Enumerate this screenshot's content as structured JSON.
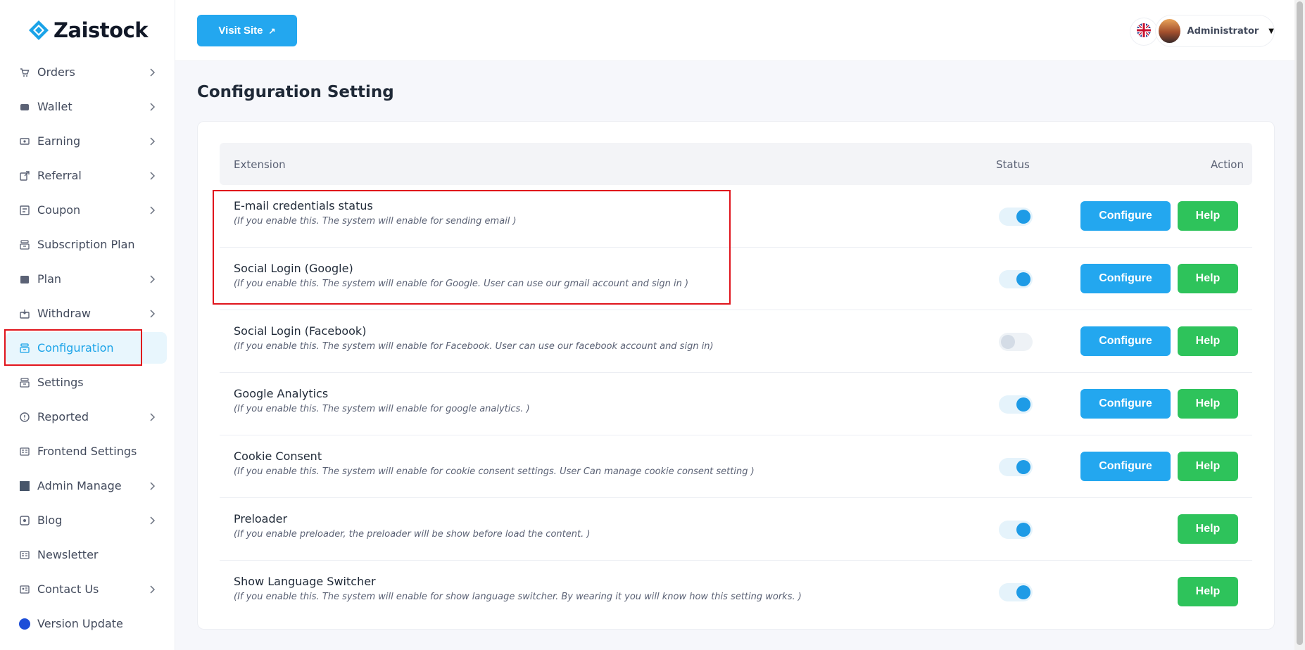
{
  "app": {
    "logo_text": "Zaistock",
    "brand_color": "#1aa3e8"
  },
  "sidebar": {
    "items": [
      {
        "label": "Orders",
        "icon": "cart-icon",
        "has_chevron": true,
        "active": false
      },
      {
        "label": "Wallet",
        "icon": "wallet-icon",
        "has_chevron": true,
        "active": false
      },
      {
        "label": "Earning",
        "icon": "money-icon",
        "has_chevron": true,
        "active": false
      },
      {
        "label": "Referral",
        "icon": "share-icon",
        "has_chevron": true,
        "active": false
      },
      {
        "label": "Coupon",
        "icon": "coupon-icon",
        "has_chevron": true,
        "active": false
      },
      {
        "label": "Subscription Plan",
        "icon": "stack-icon",
        "has_chevron": false,
        "active": false
      },
      {
        "label": "Plan",
        "icon": "calendar-icon",
        "has_chevron": true,
        "active": false
      },
      {
        "label": "Withdraw",
        "icon": "withdraw-icon",
        "has_chevron": true,
        "active": false
      },
      {
        "label": "Configuration",
        "icon": "stack-icon",
        "has_chevron": false,
        "active": true
      },
      {
        "label": "Settings",
        "icon": "stack-icon",
        "has_chevron": false,
        "active": false
      },
      {
        "label": "Reported",
        "icon": "alert-icon",
        "has_chevron": true,
        "active": false
      },
      {
        "label": "Frontend Settings",
        "icon": "layout-icon",
        "has_chevron": false,
        "active": false
      },
      {
        "label": "Admin Manage",
        "icon": "square-icon",
        "has_chevron": true,
        "active": false
      },
      {
        "label": "Blog",
        "icon": "blog-icon",
        "has_chevron": true,
        "active": false
      },
      {
        "label": "Newsletter",
        "icon": "layout-icon",
        "has_chevron": false,
        "active": false
      },
      {
        "label": "Contact Us",
        "icon": "contact-card-icon",
        "has_chevron": true,
        "active": false
      },
      {
        "label": "Version Update",
        "icon": "circle-icon",
        "has_chevron": false,
        "active": false
      }
    ]
  },
  "topbar": {
    "visit_label": "Visit Site",
    "visit_icon": "external-arrow-icon",
    "language_icon": "uk-flag-icon",
    "user_name": "Administrator",
    "user_caret": "▼"
  },
  "page": {
    "title": "Configuration Setting"
  },
  "table": {
    "headers": {
      "extension": "Extension",
      "status": "Status",
      "action": "Action"
    },
    "configure_label": "Configure",
    "help_label": "Help",
    "rows": [
      {
        "title": "E-mail credentials status",
        "desc": "(If you enable this. The system will enable for sending email )",
        "enabled": true,
        "configurable": true
      },
      {
        "title": "Social Login (Google)",
        "desc": "(If you enable this. The system will enable for Google. User can use our gmail account and sign in )",
        "enabled": true,
        "configurable": true
      },
      {
        "title": "Social Login (Facebook)",
        "desc": "(If you enable this. The system will enable for Facebook. User can use our facebook account and sign in)",
        "enabled": false,
        "configurable": true
      },
      {
        "title": "Google Analytics",
        "desc": "(If you enable this. The system will enable for google analytics. )",
        "enabled": true,
        "configurable": true
      },
      {
        "title": "Cookie Consent",
        "desc": "(If you enable this. The system will enable for cookie consent settings. User Can manage cookie consent setting )",
        "enabled": true,
        "configurable": true
      },
      {
        "title": "Preloader",
        "desc": "(If you enable preloader, the preloader will be show before load the content. )",
        "enabled": true,
        "configurable": false
      },
      {
        "title": "Show Language Switcher",
        "desc": "(If you enable this. The system will enable for show language switcher. By wearing it you will know how this setting works. )",
        "enabled": true,
        "configurable": false
      }
    ]
  },
  "colors": {
    "primary": "#23a7ef",
    "help": "#2ec35b",
    "highlight": "#e0141c"
  }
}
